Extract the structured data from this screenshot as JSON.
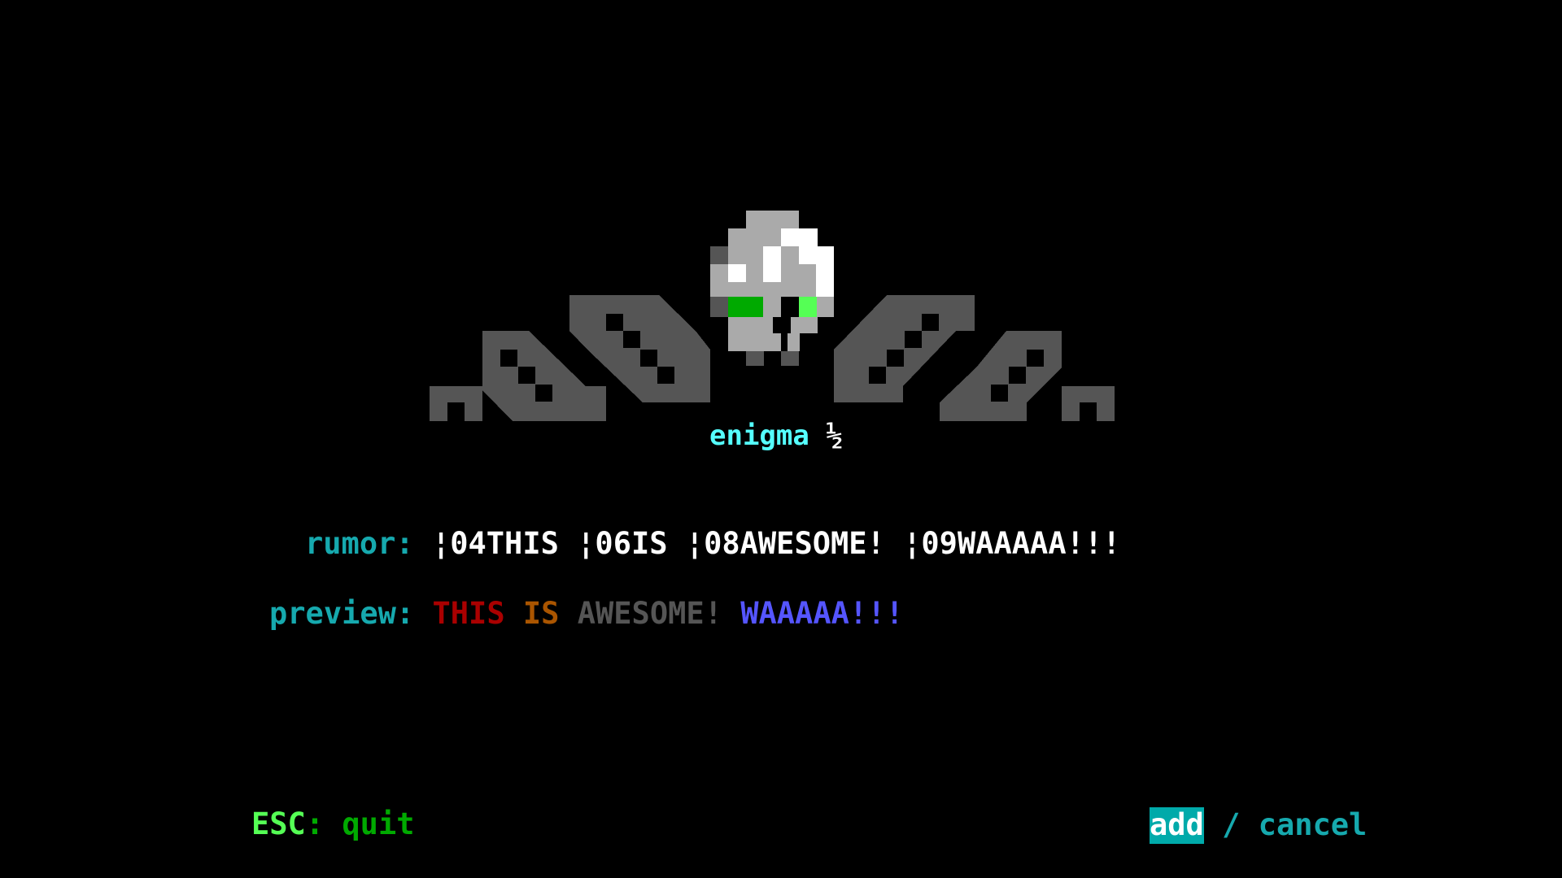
{
  "logo": {
    "title": "enigma",
    "suffix": "½"
  },
  "rumor": {
    "label": "rumor:",
    "value": "¦04THIS ¦06IS ¦08AWESOME! ¦09WAAAAA!!!"
  },
  "preview": {
    "label": "preview:",
    "segments": [
      {
        "text": "THIS",
        "color": "#aa0000"
      },
      {
        "text": "IS",
        "color": "#aa5500"
      },
      {
        "text": "AWESOME!",
        "color": "#555555"
      },
      {
        "text": "WAAAAA!!!",
        "color": "#5555ff"
      }
    ]
  },
  "footer": {
    "esc_key": "ESC",
    "esc_sep": ":",
    "esc_action": "quit",
    "add_label": "add",
    "slash": "/",
    "cancel_label": "cancel"
  },
  "colors": {
    "background": "#000000",
    "label": "#16a9ae",
    "logo_text": "#55ffff",
    "selected_bg": "#00aaaa"
  }
}
